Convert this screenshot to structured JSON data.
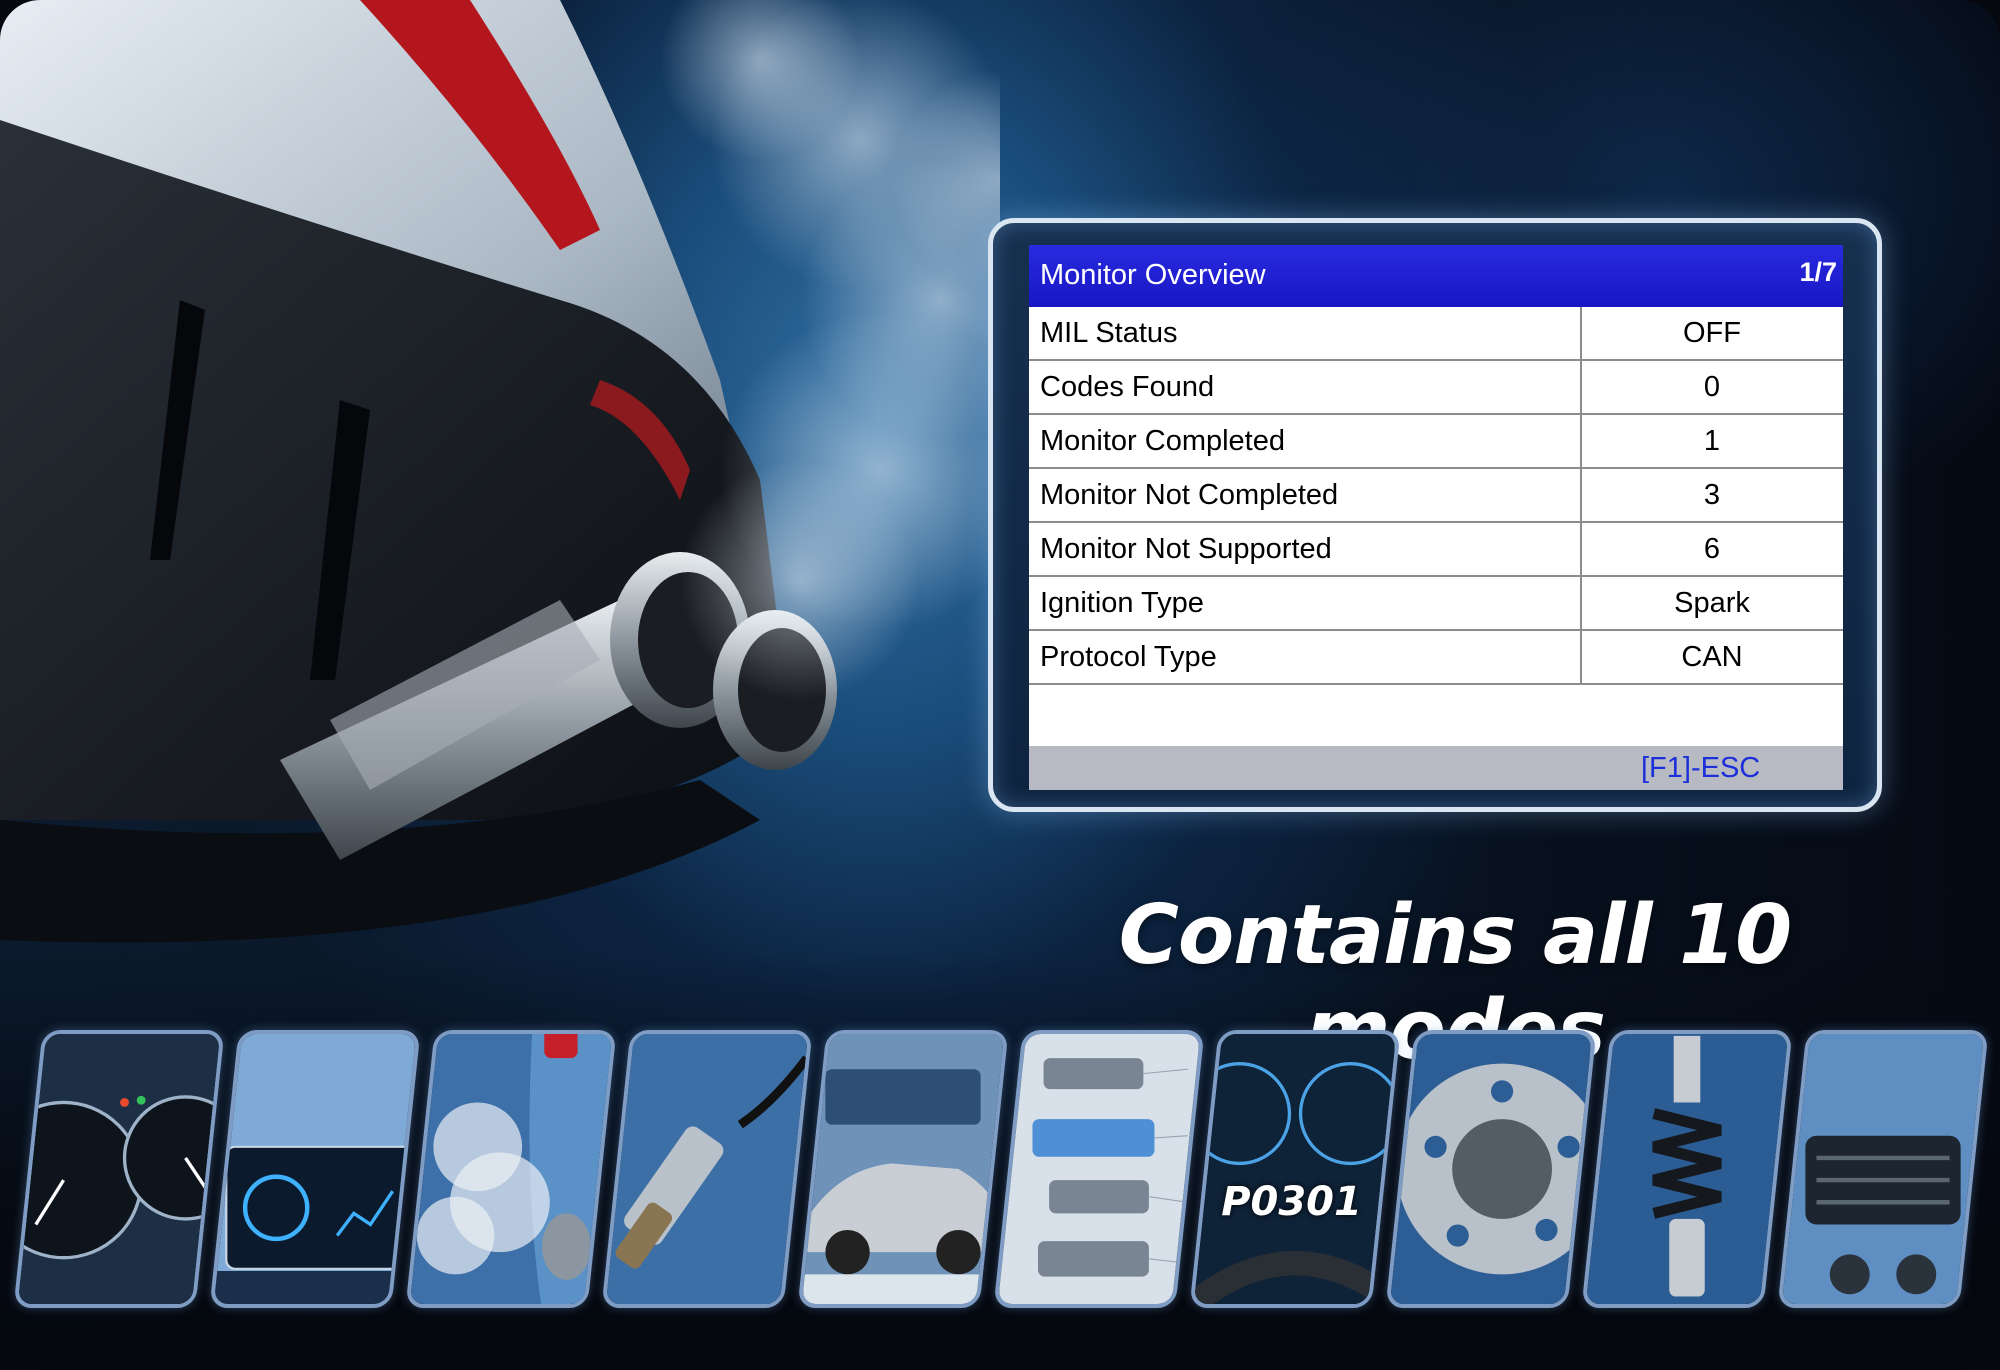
{
  "scanner_screen": {
    "title": "Monitor Overview",
    "page_indicator": "1/7",
    "rows": [
      {
        "label": "MIL Status",
        "value": "OFF"
      },
      {
        "label": "Codes Found",
        "value": "0"
      },
      {
        "label": "Monitor Completed",
        "value": "1"
      },
      {
        "label": "Monitor Not Completed",
        "value": "3"
      },
      {
        "label": "Monitor Not Supported",
        "value": "6"
      },
      {
        "label": "Ignition Type",
        "value": "Spark"
      },
      {
        "label": "Protocol Type",
        "value": "CAN"
      }
    ],
    "footer_key": "[F1]-ESC",
    "colors": {
      "header": "#1d1dd0",
      "footer": "#b7bac2",
      "footer_text": "#1c2fd9"
    }
  },
  "headline": "Contains all 10 modes",
  "thumbnails": [
    {
      "icon": "instrument-cluster-icon"
    },
    {
      "icon": "dashboard-display-icon"
    },
    {
      "icon": "exhaust-smoke-icon"
    },
    {
      "icon": "oxygen-sensor-icon"
    },
    {
      "icon": "car-icon"
    },
    {
      "icon": "vehicle-parts-diagram-icon"
    },
    {
      "icon": "trouble-code-dashboard-icon",
      "code": "P0301"
    },
    {
      "icon": "brake-disc-icon"
    },
    {
      "icon": "shock-absorber-icon"
    },
    {
      "icon": "air-vent-icon"
    }
  ]
}
